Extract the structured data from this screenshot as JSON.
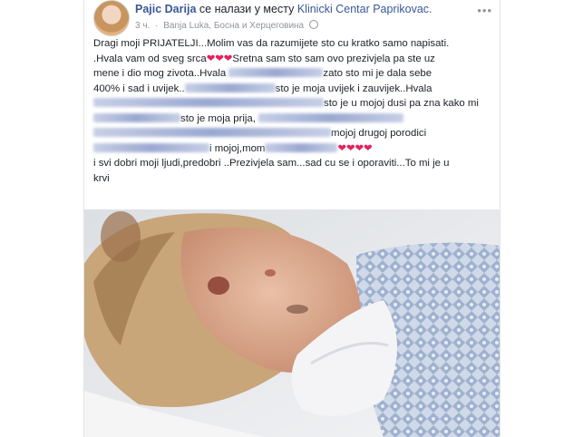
{
  "post": {
    "author": "Pajic Darija",
    "location_prefix": "се налази у месту",
    "location": "Klinicki Centar Paprikovac.",
    "time": "3 ч.",
    "place": "Banja Luka, Босна и Херцеговина"
  },
  "text": {
    "line1": "Dragi moji PRIJATELJI...Molim vas da razumijete sto cu kratko samo napisati.",
    "line2a": ".Hvala vam od sveg srca",
    "line2b": "Sretna sam sto sam ovo prezivjela pa ste uz",
    "line3a": "mene i dio mog zivota..Hvala",
    "line3b": "zato sto mi je dala sebe",
    "line4a": "400% i sad i uvijek..",
    "line4b": "sto je moja uvijek i zauvijek..Hvala",
    "line5": "sto je u mojoj dusi pa zna kako mi",
    "line6": "sto je moja prija,",
    "line7": "mojoj drugoj porodici",
    "line8": "i mojoj,mom",
    "line9": "i svi dobri moji ljudi,predobri ..Prezivjela sam...sad cu se i oporaviti...To mi je u",
    "line10": "krvi",
    "hearts3": "❤❤❤",
    "hearts4": "❤❤❤❤"
  },
  "icons": {
    "globe": "globe-icon",
    "menu": "more-options-icon"
  }
}
